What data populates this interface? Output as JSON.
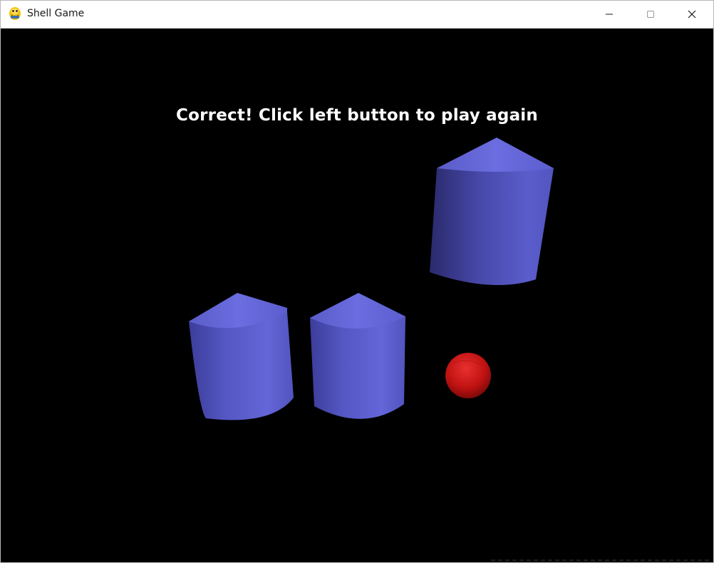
{
  "window": {
    "title": "Shell Game",
    "app_icon": "python-snake-icon"
  },
  "controls": {
    "minimize_icon": "minimize-icon",
    "maximize_icon": "maximize-icon",
    "close_icon": "close-icon"
  },
  "game": {
    "message": "Correct! Click left button to play again",
    "cup_color": "#5a5ccc",
    "ball_color": "#cc1414",
    "background_color": "#000000"
  }
}
